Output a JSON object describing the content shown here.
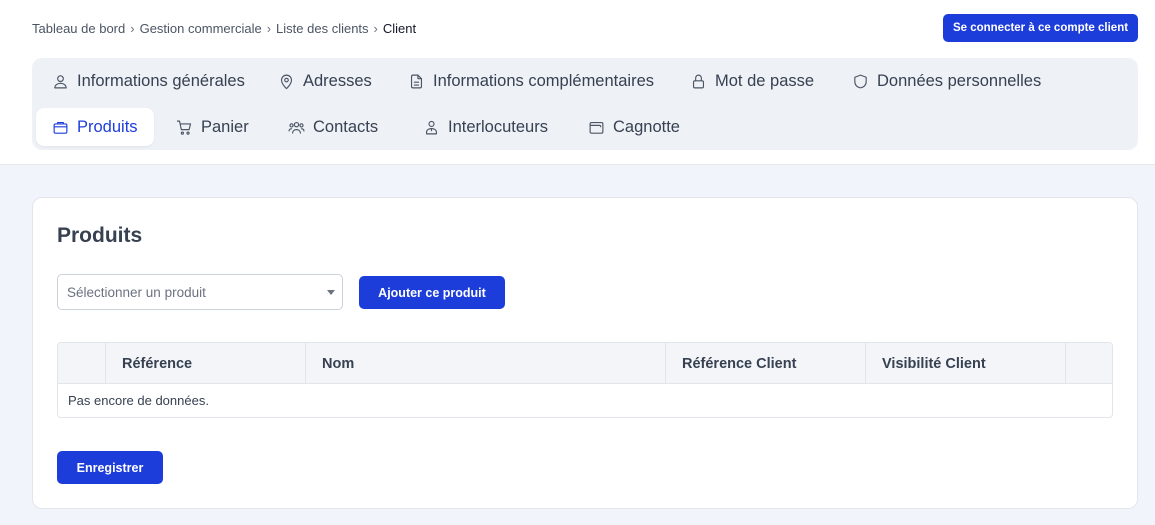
{
  "breadcrumb": {
    "items": [
      "Tableau de bord",
      "Gestion commerciale",
      "Liste des clients"
    ],
    "separator": "›",
    "current": "Client"
  },
  "header": {
    "connect_label": "Se connecter à ce compte client"
  },
  "tabs": [
    {
      "label": "Informations générales",
      "icon": "user-icon",
      "active": false
    },
    {
      "label": "Adresses",
      "icon": "map-pin-icon",
      "active": false
    },
    {
      "label": "Informations complémentaires",
      "icon": "document-icon",
      "active": false
    },
    {
      "label": "Mot de passe",
      "icon": "lock-icon",
      "active": false
    },
    {
      "label": "Données personnelles",
      "icon": "shield-icon",
      "active": false
    },
    {
      "label": "Produits",
      "icon": "box-icon",
      "active": true
    },
    {
      "label": "Panier",
      "icon": "cart-icon",
      "active": false
    },
    {
      "label": "Contacts",
      "icon": "users-icon",
      "active": false
    },
    {
      "label": "Interlocuteurs",
      "icon": "person-icon",
      "active": false
    },
    {
      "label": "Cagnotte",
      "icon": "wallet-icon",
      "active": false
    }
  ],
  "products": {
    "title": "Produits",
    "select_placeholder": "Sélectionner un produit",
    "add_label": "Ajouter ce produit",
    "table": {
      "columns": [
        "",
        "Référence",
        "Nom",
        "Référence Client",
        "Visibilité Client",
        ""
      ],
      "empty_text": "Pas encore de données."
    },
    "save_label": "Enregistrer"
  },
  "colors": {
    "primary": "#1d3ddb",
    "page_background": "#f1f4fa",
    "tabs_background": "#eef1f6"
  }
}
